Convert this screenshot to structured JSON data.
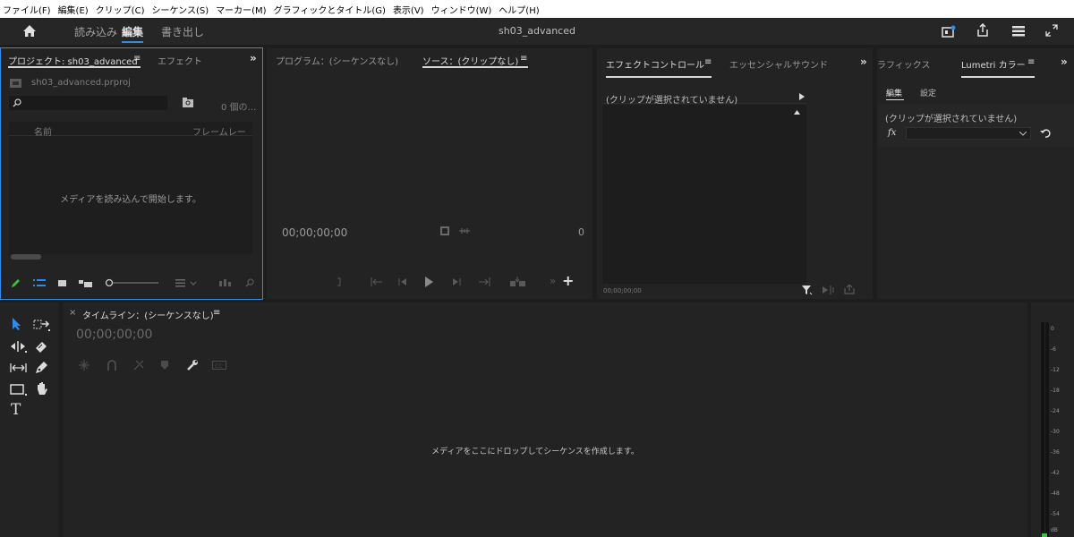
{
  "menu": [
    "ファイル(F)",
    "編集(E)",
    "クリップ(C)",
    "シーケンス(S)",
    "マーカー(M)",
    "グラフィックとタイトル(G)",
    "表示(V)",
    "ウィンドウ(W)",
    "ヘルプ(H)"
  ],
  "header": {
    "tabs": [
      "読み込み",
      "編集",
      "書き出し"
    ],
    "active_tab": "編集",
    "document_title": "sh03_advanced"
  },
  "project_panel": {
    "tab_project": "プロジェクト: sh03_advanced",
    "tab_menu": "≡",
    "tab_effects": "エフェクト",
    "overflow": "»",
    "file_name": "sh03_advanced.prproj",
    "search_placeholder": "",
    "item_count": "0 個の…",
    "col_name": "名前",
    "col_framerate": "フレームレート",
    "empty_message": "メディアを読み込んで開始します。"
  },
  "program_panel": {
    "tab_program": "プログラム：(シーケンスなし)",
    "tab_source": "ソース：(クリップなし)",
    "tab_menu": "≡",
    "timecode": "00;00;00;00",
    "frame_value": "0"
  },
  "effect_controls": {
    "tab_effect_controls": "エフェクトコントロール",
    "tab_menu": "≡",
    "tab_essential_sound": "エッセンシャルサウンド",
    "overflow": "»",
    "no_clip": "(クリップが選択されていません)",
    "timecode": "00;00;00;00"
  },
  "lumetri": {
    "tab_graphics": "ラフィックス",
    "tab_lumetri": "Lumetri カラー",
    "tab_menu": "≡",
    "overflow": "»",
    "subtab_edit": "編集",
    "subtab_settings": "設定",
    "no_clip": "(クリップが選択されていません)",
    "fx_label": "fx"
  },
  "timeline": {
    "close": "×",
    "tab_label": "タイムライン：(シーケンスなし)",
    "tab_menu": "≡",
    "timecode": "00;00;00;00",
    "drop_message": "メディアをここにドロップしてシーケンスを作成します。"
  },
  "audio_meter": {
    "labels": [
      "0",
      "-6",
      "-12",
      "-18",
      "-24",
      "-30",
      "-36",
      "-42",
      "-48",
      "-54",
      "dB"
    ]
  },
  "tools": {
    "type_tool": "T"
  },
  "colors": {
    "accent_blue": "#2d8ceb",
    "panel_bg": "#232323",
    "app_bg": "#1d1d1d",
    "green_icon": "#3fbf3f"
  }
}
